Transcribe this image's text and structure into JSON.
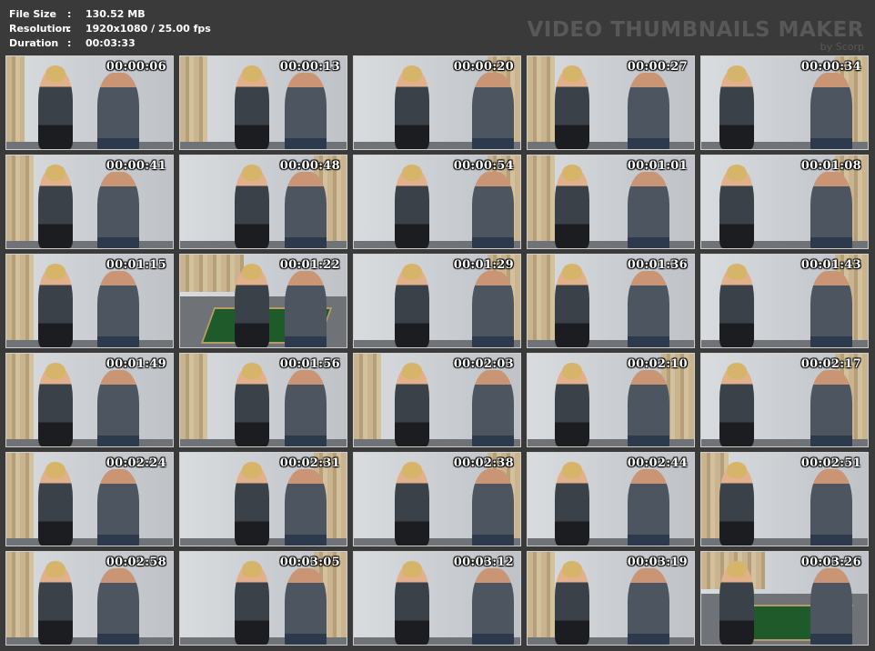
{
  "info": {
    "file_size_label": "File Size",
    "file_size_value": "130.52 MB",
    "resolution_label": "Resolution",
    "resolution_value": "1920x1080 / 25.00 fps",
    "duration_label": "Duration",
    "duration_value": "00:03:33",
    "colon": ":"
  },
  "brand": {
    "title": "VIDEO THUMBNAILS MAKER",
    "subtitle": "by Scorp"
  },
  "thumbnails": [
    "00:00:06",
    "00:00:13",
    "00:00:20",
    "00:00:27",
    "00:00:34",
    "00:00:41",
    "00:00:48",
    "00:00:54",
    "00:01:01",
    "00:01:08",
    "00:01:15",
    "00:01:22",
    "00:01:29",
    "00:01:36",
    "00:01:43",
    "00:01:49",
    "00:01:56",
    "00:02:03",
    "00:02:10",
    "00:02:17",
    "00:02:24",
    "00:02:31",
    "00:02:38",
    "00:02:44",
    "00:02:51",
    "00:02:58",
    "00:03:05",
    "00:03:12",
    "00:03:19",
    "00:03:26"
  ]
}
